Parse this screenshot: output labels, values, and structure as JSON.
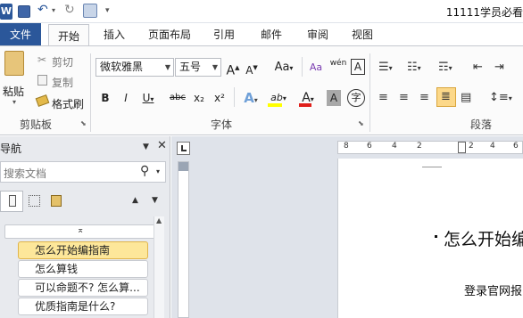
{
  "window": {
    "title": "11111学员必看"
  },
  "tabs": [
    {
      "label": "文件"
    },
    {
      "label": "开始"
    },
    {
      "label": "插入"
    },
    {
      "label": "页面布局"
    },
    {
      "label": "引用"
    },
    {
      "label": "邮件"
    },
    {
      "label": "审阅"
    },
    {
      "label": "视图"
    }
  ],
  "clipboard": {
    "paste_label": "粘贴",
    "cut_label": "剪切",
    "copy_label": "复制",
    "format_painter_label": "格式刷",
    "group_label": "剪贴板"
  },
  "font": {
    "name": "微软雅黑",
    "size": "五号",
    "group_label": "字体",
    "grow_label": "A",
    "shrink_label": "A",
    "case_label": "Aa",
    "bold": "B",
    "italic": "I",
    "underline": "U",
    "strike": "abc",
    "subscript": "x₂",
    "superscript": "x²",
    "phonetic_label": "wén",
    "char_border_label": "A",
    "text_effect_label": "A",
    "highlight_label": "ab",
    "font_color_label": "A",
    "char_shading_label": "A",
    "enclose_label": "字",
    "highlight_color": "#ffff00",
    "font_color": "#e0201b"
  },
  "paragraph": {
    "group_label": "段落"
  },
  "nav_pane": {
    "title": "导航",
    "search_placeholder": "搜索文档",
    "items": [
      {
        "label": "怎么开始编指南",
        "selected": true
      },
      {
        "label": "怎么算钱",
        "selected": false
      },
      {
        "label": "可以命题不? 怎么算...",
        "selected": false
      },
      {
        "label": "优质指南是什么?",
        "selected": false
      }
    ]
  },
  "ruler": {
    "ticks": [
      "8",
      "6",
      "4",
      "2",
      "2",
      "4",
      "6"
    ]
  },
  "document": {
    "heading": "怎么开始编",
    "body_line": "登录官网报"
  },
  "colors": {
    "accent": "#2b579a",
    "selected_item": "#fde79a"
  }
}
